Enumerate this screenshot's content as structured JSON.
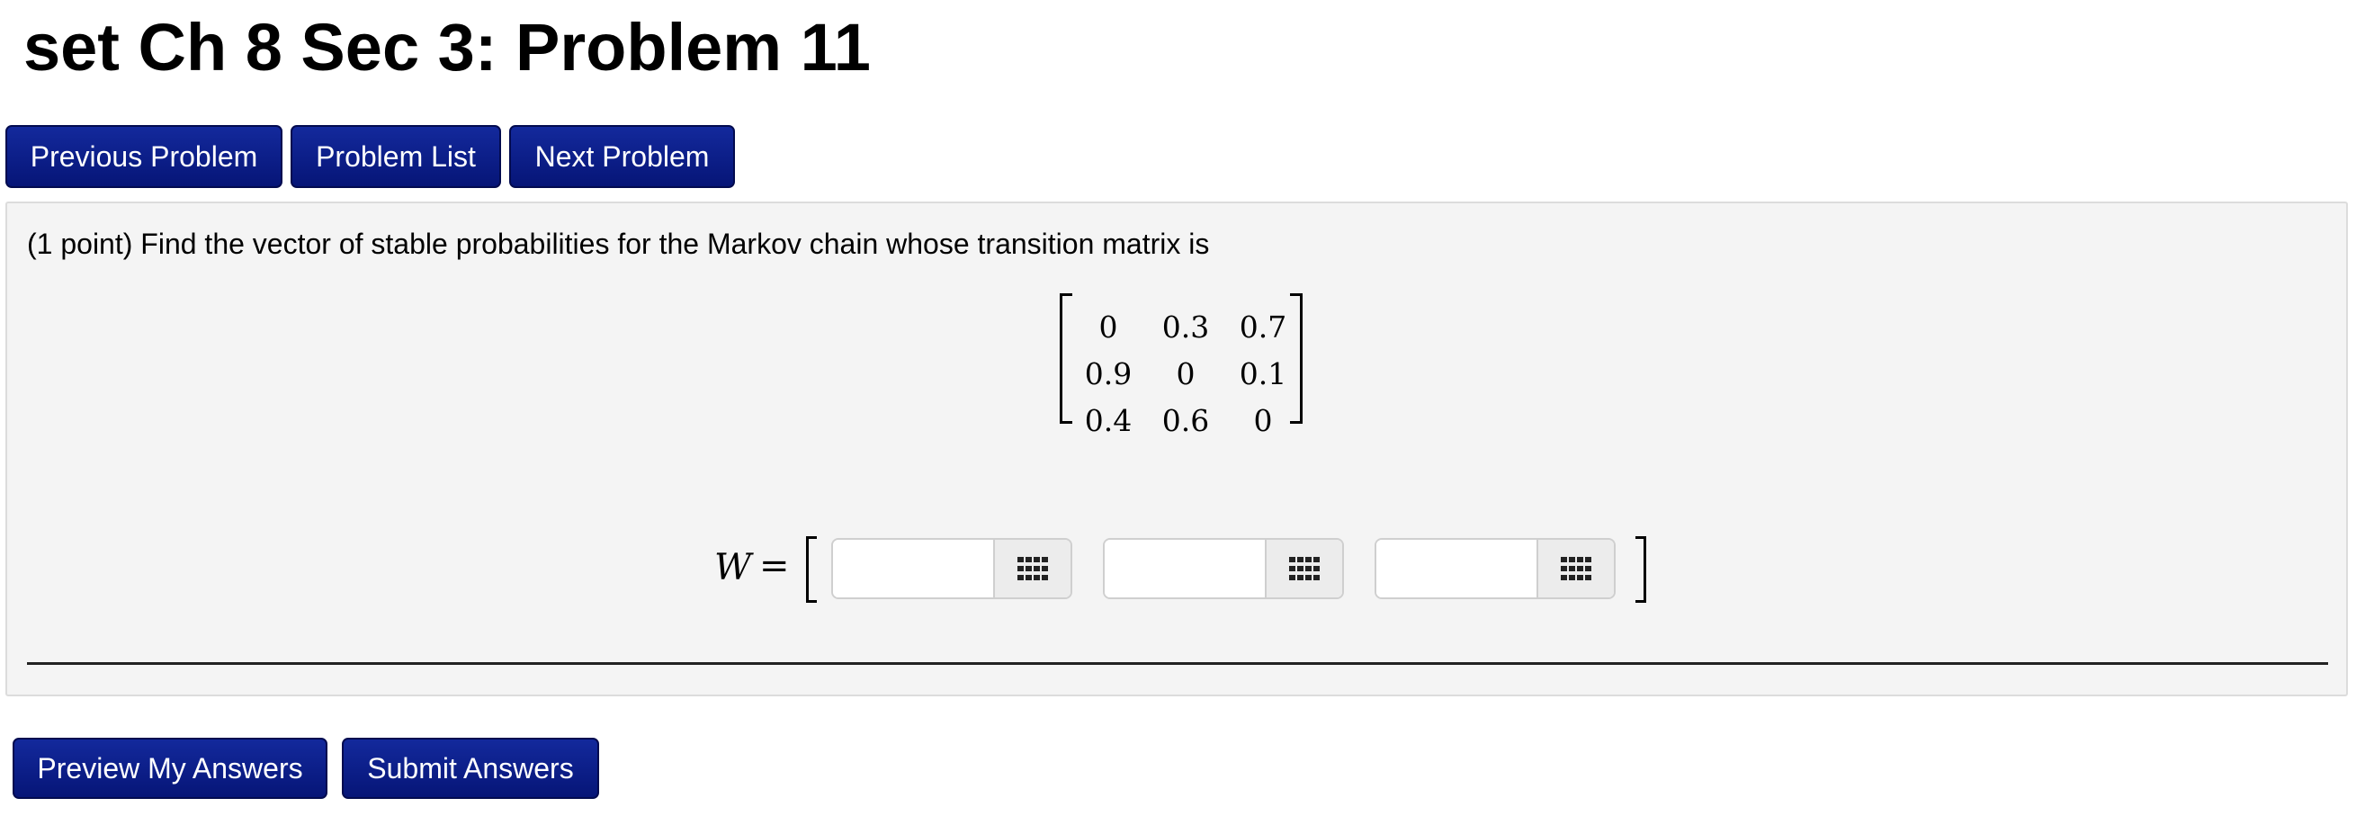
{
  "header": {
    "title": "set Ch 8 Sec 3: Problem 11"
  },
  "nav": {
    "previous_label": "Previous Problem",
    "list_label": "Problem List",
    "next_label": "Next Problem"
  },
  "problem": {
    "statement": "(1 point) Find the vector of stable probabilities for the Markov chain whose transition matrix is",
    "matrix": [
      [
        "0",
        "0.3",
        "0.7"
      ],
      [
        "0.9",
        "0",
        "0.1"
      ],
      [
        "0.4",
        "0.6",
        "0"
      ]
    ],
    "answer_label": "W",
    "answer_equals": "=",
    "answers": [
      "",
      "",
      ""
    ],
    "keypad_icon": "grid-keypad-icon"
  },
  "actions": {
    "preview_label": "Preview My Answers",
    "submit_label": "Submit Answers"
  },
  "colors": {
    "button_bg": "#0a1f8a",
    "button_text": "#ffffff",
    "problem_bg": "#f4f4f4"
  }
}
